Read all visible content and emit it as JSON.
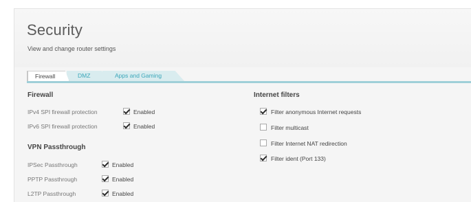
{
  "header": {
    "title": "Security",
    "subtitle": "View and change router settings"
  },
  "tabs": [
    {
      "label": "Firewall",
      "active": true
    },
    {
      "label": "DMZ",
      "active": false
    },
    {
      "label": "Apps and Gaming",
      "active": false
    }
  ],
  "firewall": {
    "title": "Firewall",
    "rows": [
      {
        "label": "IPv4 SPI firewall protection",
        "checked": true,
        "value": "Enabled"
      },
      {
        "label": "IPv6 SPI firewall protection",
        "checked": true,
        "value": "Enabled"
      }
    ]
  },
  "vpn": {
    "title": "VPN Passthrough",
    "rows": [
      {
        "label": "IPSec Passthrough",
        "checked": true,
        "value": "Enabled"
      },
      {
        "label": "PPTP Passthrough",
        "checked": true,
        "value": "Enabled"
      },
      {
        "label": "L2TP Passthrough",
        "checked": true,
        "value": "Enabled"
      }
    ]
  },
  "internet_filters": {
    "title": "Internet filters",
    "items": [
      {
        "label": "Filter anonymous Internet requests",
        "checked": true
      },
      {
        "label": "Filter multicast",
        "checked": false
      },
      {
        "label": "Filter Internet NAT redirection",
        "checked": false
      },
      {
        "label": "Filter ident (Port 133)",
        "checked": true
      }
    ]
  },
  "colors": {
    "panel_bg": "#f5f5f5",
    "tab_inactive_bg": "#d9ecef",
    "tab_inactive_text": "#3aa6b9",
    "accent_rule": "#9fcfd8"
  }
}
